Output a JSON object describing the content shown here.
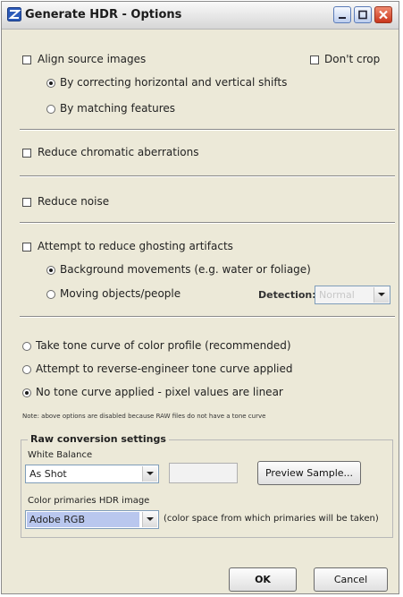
{
  "window": {
    "title": "Generate HDR - Options"
  },
  "titlebar_buttons": {
    "minimize": "minimize",
    "maximize": "maximize",
    "close": "close"
  },
  "align": {
    "label": "Align source images",
    "checked": false,
    "dont_crop": {
      "label": "Don't crop",
      "checked": false
    },
    "options": [
      {
        "label": "By correcting horizontal and vertical shifts",
        "selected": true
      },
      {
        "label": "By matching features",
        "selected": false
      }
    ]
  },
  "chromatic": {
    "label": "Reduce chromatic aberrations",
    "checked": false
  },
  "noise": {
    "label": "Reduce noise",
    "checked": false
  },
  "ghosting": {
    "label": "Attempt to reduce ghosting artifacts",
    "checked": false,
    "options": [
      {
        "label": "Background movements (e.g. water or foliage)",
        "selected": true
      },
      {
        "label": "Moving objects/people",
        "selected": false
      }
    ],
    "detection_label": "Detection:",
    "detection_value": "Normal"
  },
  "tone_curve": {
    "options": [
      {
        "label": "Take tone curve of color profile (recommended)",
        "selected": false
      },
      {
        "label": "Attempt to reverse-engineer tone curve applied",
        "selected": false
      },
      {
        "label": "No tone curve applied - pixel values are linear",
        "selected": true
      }
    ],
    "note": "Note: above options are disabled because RAW files do not have a tone curve"
  },
  "raw": {
    "group_title": "Raw conversion settings",
    "white_balance_label": "White Balance",
    "white_balance_value": "As Shot",
    "preview_button": "Preview Sample...",
    "color_primaries_label": "Color primaries HDR image",
    "color_primaries_value": "Adobe RGB",
    "color_primaries_hint": "(color space from which primaries will be taken)"
  },
  "buttons": {
    "ok": "OK",
    "cancel": "Cancel"
  },
  "colors": {
    "window_bg": "#ece9d8",
    "selection": "#b9c7ee",
    "close_button": "#d9472b"
  }
}
